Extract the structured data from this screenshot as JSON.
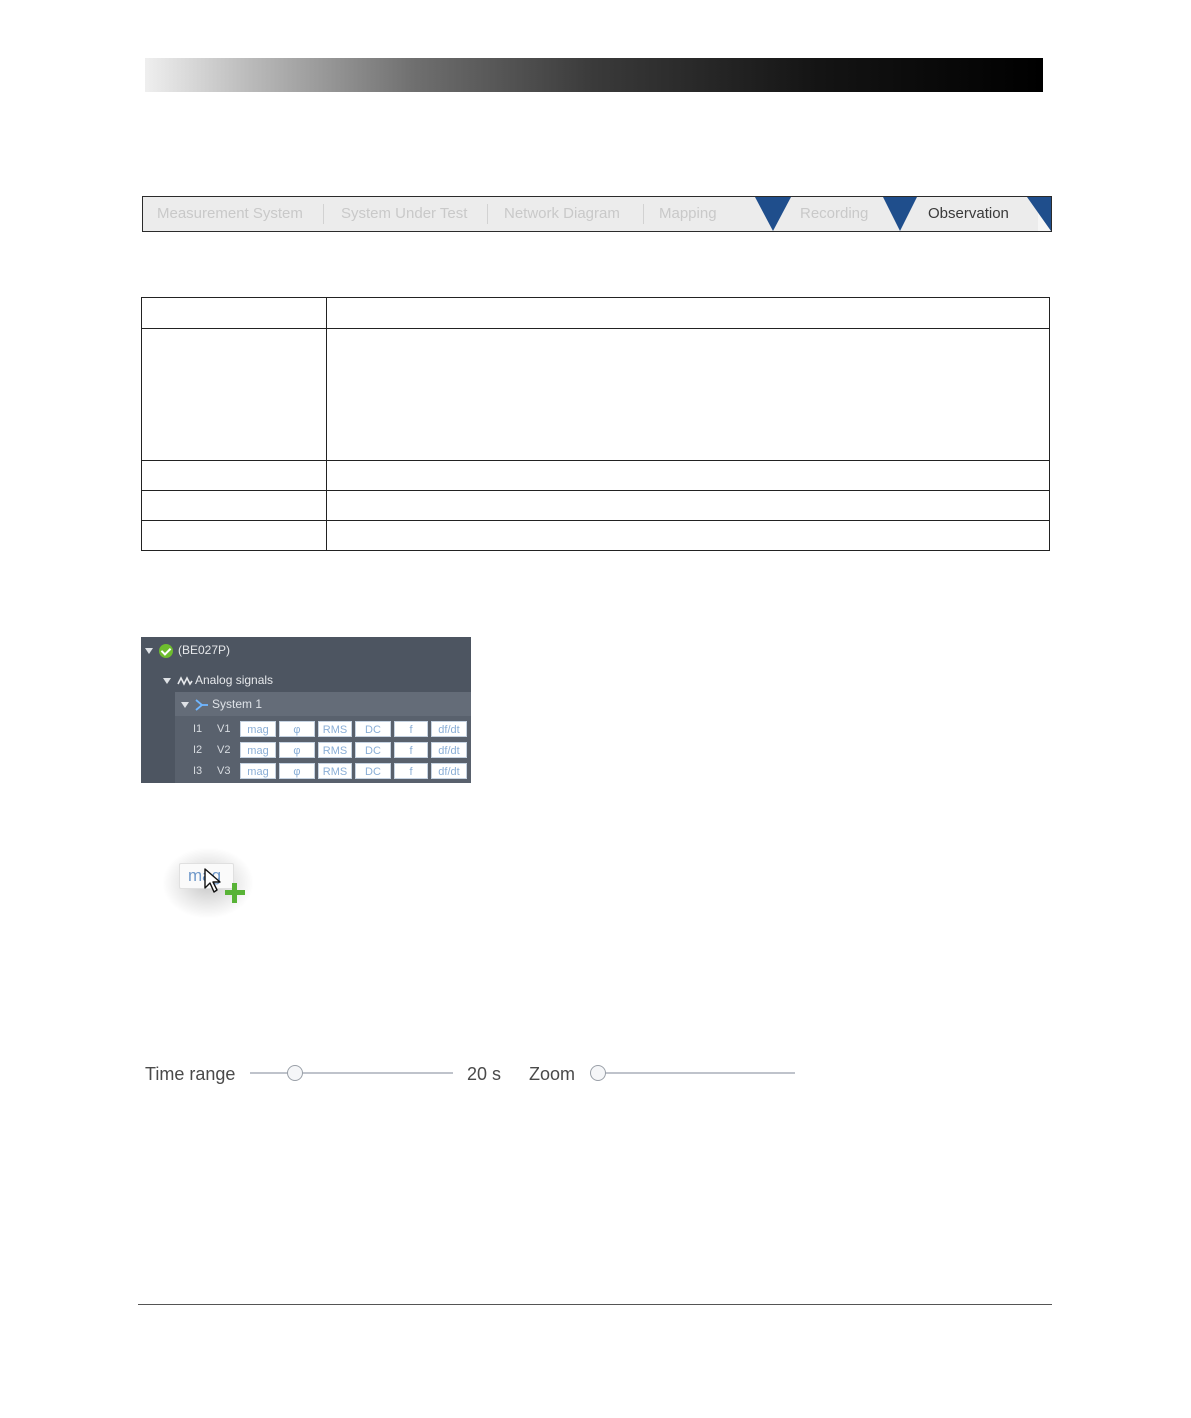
{
  "workflow_tabs": {
    "items": [
      {
        "label": "Measurement System"
      },
      {
        "label": "System Under Test"
      },
      {
        "label": "Network Diagram"
      },
      {
        "label": "Mapping"
      },
      {
        "label": "Recording"
      },
      {
        "label": "Observation"
      }
    ],
    "active": "Observation",
    "accent_color": "#1f4e8c"
  },
  "signal_tree": {
    "device_label": "(BE027P)",
    "device_status_icon": "check-circle-icon",
    "group_label": "Analog signals",
    "system_label": "System 1",
    "rows": [
      {
        "current": "I1",
        "voltage": "V1",
        "cells": [
          "mag",
          "φ",
          "RMS",
          "DC",
          "f",
          "df/dt"
        ]
      },
      {
        "current": "I2",
        "voltage": "V2",
        "cells": [
          "mag",
          "φ",
          "RMS",
          "DC",
          "f",
          "df/dt"
        ]
      },
      {
        "current": "I3",
        "voltage": "V3",
        "cells": [
          "mag",
          "φ",
          "RMS",
          "DC",
          "f",
          "df/dt"
        ]
      }
    ]
  },
  "drag_badge": {
    "text": "mag"
  },
  "controls": {
    "time_range_label": "Time range",
    "time_range_value": "20 s",
    "time_range_level": 0.22,
    "zoom_label": "Zoom",
    "zoom_level": 0.0
  }
}
